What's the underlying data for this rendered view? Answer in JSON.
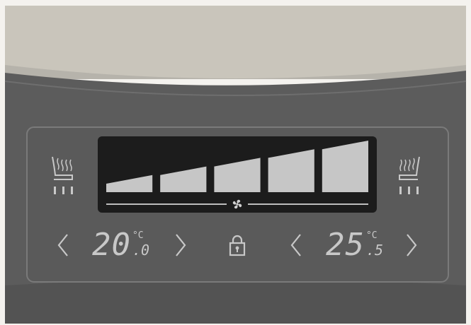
{
  "climate": {
    "fan_level": 5,
    "fan_max": 5,
    "driver": {
      "temp_whole": "20",
      "temp_unit": "°C",
      "temp_decimal": ".0",
      "seat_heat_level": 3
    },
    "passenger": {
      "temp_whole": "25",
      "temp_unit": "°C",
      "temp_decimal": ".5",
      "seat_heat_level": 3
    }
  },
  "icons": {
    "seat_heat": "heated-seat-icon",
    "fan": "fan-icon",
    "lock": "lock-icon",
    "decrease": "chevron-left-icon",
    "increase": "chevron-right-icon"
  },
  "colors": {
    "display_text": "#c8c8c8",
    "screen_bg": "#1c1c1c",
    "panel_bg": "#5a5a5a"
  }
}
